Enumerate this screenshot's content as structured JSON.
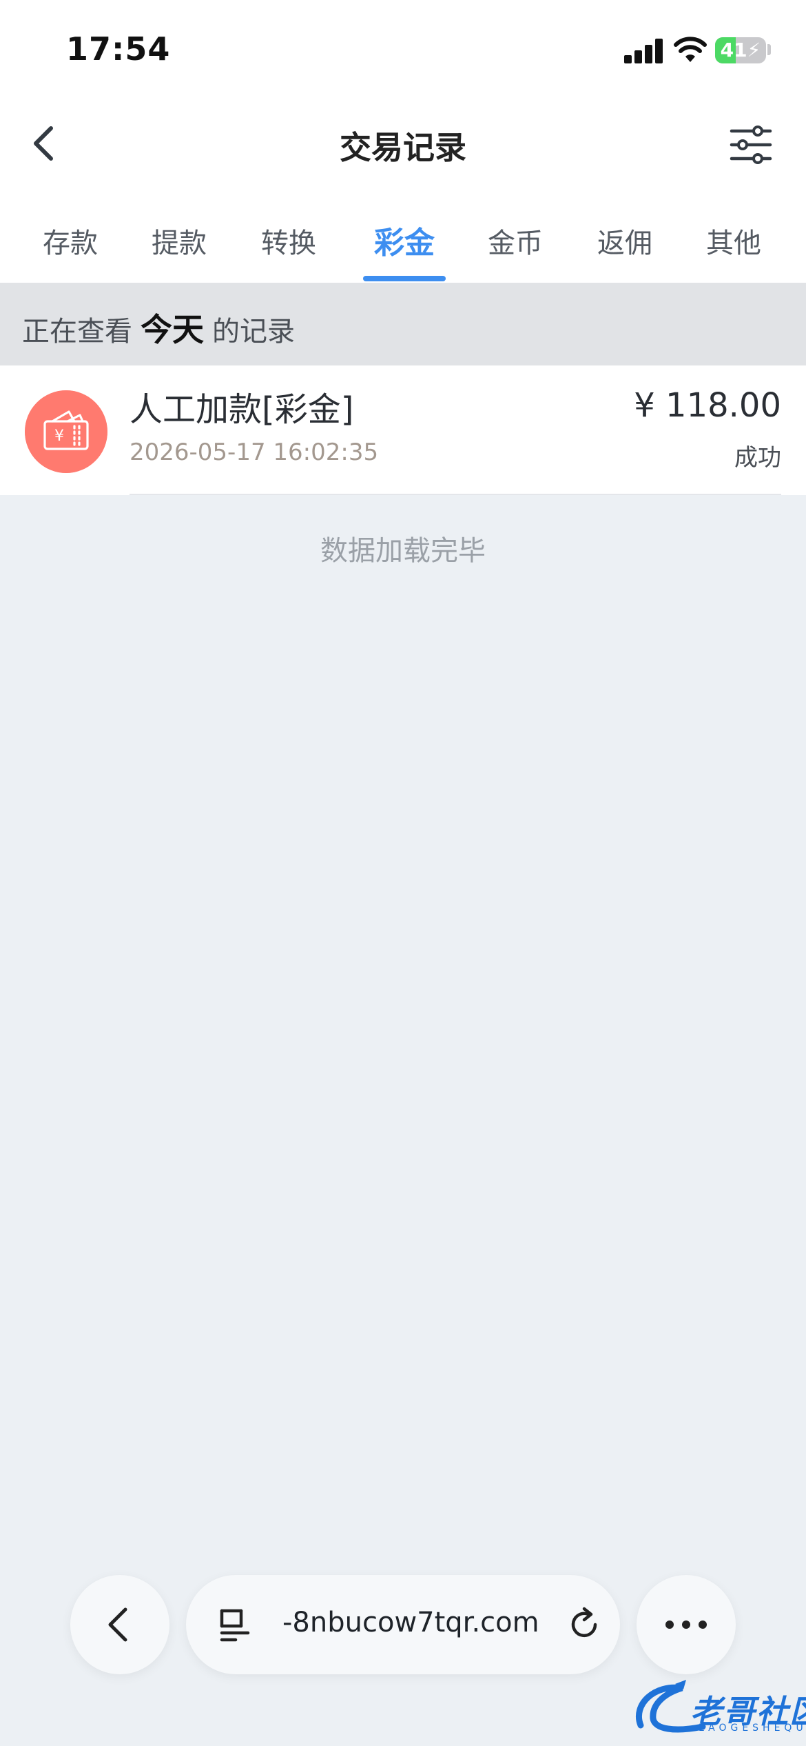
{
  "status_bar": {
    "time": "17:54",
    "battery_level": "41",
    "icons": [
      "signal-icon",
      "wifi-icon",
      "battery-charging-icon"
    ]
  },
  "nav": {
    "title": "交易记录",
    "back_icon": "chevron-left-icon",
    "filter_icon": "filter-sliders-icon"
  },
  "tabs": [
    {
      "label": "存款",
      "active": false
    },
    {
      "label": "提款",
      "active": false
    },
    {
      "label": "转换",
      "active": false
    },
    {
      "label": "彩金",
      "active": true
    },
    {
      "label": "金币",
      "active": false
    },
    {
      "label": "返佣",
      "active": false
    },
    {
      "label": "其他",
      "active": false
    }
  ],
  "viewing": {
    "prefix": "正在查看",
    "period": "今天",
    "suffix": "的记录"
  },
  "records": [
    {
      "title": "人工加款[彩金]",
      "time": "2026-05-17 16:02:35",
      "amount": "¥ 118.00",
      "status": "成功",
      "icon": "wallet-yuan-icon"
    }
  ],
  "list_end_text": "数据加载完毕",
  "browser_bar": {
    "url": "-8nbucow7tqr.com",
    "back_icon": "chevron-left-icon",
    "tabs_icon": "reader-menu-icon",
    "reload_icon": "reload-icon",
    "more_icon": "more-dots-icon"
  },
  "watermark": {
    "text": "老哥社区",
    "sub": "LAOGESHEQU"
  },
  "colors": {
    "accent": "#3d8ef0",
    "record_icon_bg": "#ff7a6f",
    "page_bg": "#ecf0f4"
  }
}
